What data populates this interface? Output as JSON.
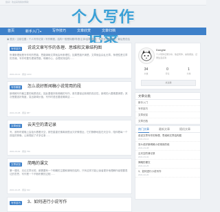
{
  "top_bar": {
    "left_text": "您好！欢迎来到我的博客！",
    "right_text": ""
  },
  "logo": {
    "text": "个人写作记录"
  },
  "nav": {
    "items": [
      {
        "label": "首页",
        "dropdown": false
      },
      {
        "label": "新手入门",
        "dropdown": true
      },
      {
        "label": "写作技巧",
        "dropdown": false
      },
      {
        "label": "文章欣赏",
        "dropdown": false
      },
      {
        "label": "文章归档",
        "dropdown": false
      }
    ]
  },
  "breadcrumb": {
    "text": "▣ 首页 › 当前位置：个人写作记录 › 写作教程，结构一般是标题/导语/主体/结尾/背景，有时会省略背景，最后是总结"
  },
  "articles": [
    {
      "tag": "写作技巧",
      "title": "说说文章写作的条理、思维和文章结构图",
      "excerpt": "所谓条理就是写作时的思路，思路清晰文章就会有条理性；如果思路不清楚，文章就会杂乱无章。条理性是文章的灵魂，写作时要先理清思路，明确中心，合理安排结构……",
      "meta": "2021-03-12 · 阅读 1263"
    },
    {
      "tag": "写作教程",
      "title": "怎么说好新闻稿小说常用的段",
      "excerpt": "新闻稿写作最主要的就是真实，因此要做好新闻稿的写作，首先要保证新闻的真实性，新闻的六要素要清楚；其次是要选好角度，突出新闻价值，写作时语言要准确简洁……",
      "meta": "2021-03-08 · 阅读 987"
    },
    {
      "tag": "文章欣赏",
      "title": "云天空的清记录",
      "excerpt": "写，我有时候晚上会抬头看看天空，那些星星仿佛离我很远又好像很近，它们静静地挂在天空中，陪伴着每一个孤独的夜晚，让我想起了许多往事……",
      "meta": "2021-03-02 · 阅读 756"
    },
    {
      "tag": "文章欣赏",
      "title": "简略的课文",
      "excerpt": "第一课本，无论文章长短，都需要有一个明确的主题和清晰的结构，只有这样才能让读者更好地理解作者想要表达的意思，写作是一个不断积累的过程……",
      "meta": "2021-02-25 · 阅读 642"
    },
    {
      "tag": "写作技巧",
      "title": "3、如何进行小说写作",
      "excerpt": "",
      "meta": ""
    }
  ],
  "profile": {
    "name": "Donghe",
    "desc": "个人写作记录分享，热爱写作，喜欢阅读，记录生活点滴",
    "stats": [
      {
        "num": "34",
        "label": "文章"
      },
      {
        "num": "0",
        "label": "评论"
      },
      {
        "num": "1",
        "label": "分类"
      }
    ],
    "follow_label": "关注我"
  },
  "categories": {
    "title": "文章分类",
    "items": [
      "新手入门",
      "写作技巧",
      "文章欣赏",
      "文章归档"
    ]
  },
  "popular": {
    "tabs": [
      "热门文章",
      "最新文章",
      "随机文章"
    ],
    "items": [
      {
        "title": "说说文章写作的条理、思维和文章结构图",
        "date": "2021-03-12"
      },
      {
        "title": "怎么说好新闻稿小说常用的段",
        "date": "2021-03-08"
      },
      {
        "title": "云天空的清记录",
        "date": "2021-03-02"
      },
      {
        "title": "简略的课文",
        "date": "2021-02-25"
      },
      {
        "title": "3、如何进行小说写作",
        "date": "2021-02-20"
      }
    ]
  },
  "colors": {
    "accent": "#3d80c9",
    "logo": "#3aa0d6",
    "background": "#eef1f4"
  }
}
